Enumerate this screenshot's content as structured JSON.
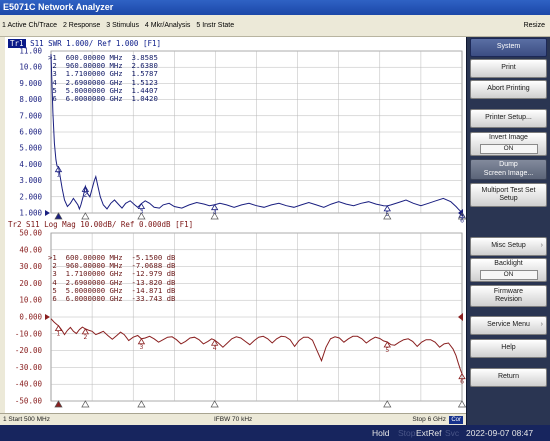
{
  "window": {
    "title": "E5071C Network Analyzer"
  },
  "menu": {
    "items": [
      "1 Active Ch/Trace",
      "2 Response",
      "3 Stimulus",
      "4 Mkr/Analysis",
      "5 Instr State"
    ],
    "resize_label": "Resize"
  },
  "chart_data": [
    {
      "type": "line",
      "trace_tag": "Tr1",
      "header": "S11  SWR 1.000/ Ref 1.000 [F1]",
      "y_tick_labels": [
        "11.00",
        "10.00",
        "9.000",
        "8.000",
        "7.000",
        "6.000",
        "5.000",
        "4.000",
        "3.000",
        "2.000",
        "1.000"
      ],
      "ylim": [
        1,
        11
      ],
      "xlim_mhz": [
        500,
        6000
      ],
      "reference_marker_label": "1.000",
      "markers": [
        {
          "id": "1",
          "freq": "600.00000 MHz",
          "x_mhz": 600,
          "value": "3.8585",
          "y": 3.8585
        },
        {
          "id": "2",
          "freq": "960.00000 MHz",
          "x_mhz": 960,
          "value": "2.6380",
          "y": 2.638
        },
        {
          "id": "3",
          "freq": "1.7100000 GHz",
          "x_mhz": 1710,
          "value": "1.5787",
          "y": 1.5787
        },
        {
          "id": "4",
          "freq": "2.6900000 GHz",
          "x_mhz": 2690,
          "value": "1.5123",
          "y": 1.5123
        },
        {
          "id": "5",
          "freq": "5.0000000 GHz",
          "x_mhz": 5000,
          "value": "1.4407",
          "y": 1.4407
        },
        {
          "id": "6",
          "freq": "6.0000000 GHz",
          "x_mhz": 6000,
          "value": "1.0420",
          "y": 1.042
        }
      ],
      "series": [
        {
          "x": [
            500,
            510,
            525,
            545,
            565,
            580,
            600,
            620,
            650,
            680,
            720,
            760,
            800,
            830,
            860,
            880,
            900,
            930,
            960,
            990,
            1020,
            1050,
            1080,
            1100,
            1130,
            1160,
            1200,
            1250,
            1300,
            1350,
            1400,
            1450,
            1500,
            1560,
            1620,
            1660,
            1710,
            1760,
            1820,
            1880,
            1950,
            2000,
            2080,
            2150,
            2250,
            2350,
            2450,
            2550,
            2620,
            2690,
            2760,
            2850,
            2950,
            3050,
            3150,
            3250,
            3350,
            3450,
            3550,
            3650,
            3750,
            3850,
            3950,
            4050,
            4150,
            4250,
            4350,
            4450,
            4550,
            4650,
            4750,
            4850,
            4950,
            5000,
            5050,
            5150,
            5250,
            5350,
            5450,
            5550,
            5650,
            5750,
            5850,
            5920,
            5960,
            6000
          ],
          "y": [
            10.8,
            9.5,
            7.2,
            5.3,
            4.3,
            3.9,
            3.86,
            3.3,
            2.5,
            1.8,
            1.4,
            1.6,
            1.9,
            1.7,
            1.5,
            1.25,
            1.5,
            2.0,
            2.64,
            2.2,
            2.0,
            2.5,
            3.0,
            3.25,
            2.6,
            2.0,
            1.5,
            1.25,
            1.6,
            1.8,
            1.55,
            1.3,
            1.6,
            1.75,
            1.5,
            1.35,
            1.58,
            1.75,
            1.6,
            1.35,
            1.3,
            1.5,
            1.6,
            1.4,
            1.3,
            1.5,
            1.65,
            1.55,
            1.45,
            1.51,
            1.6,
            1.5,
            1.35,
            1.5,
            1.6,
            1.45,
            1.35,
            1.5,
            1.6,
            1.45,
            1.35,
            1.5,
            1.65,
            1.5,
            1.35,
            1.55,
            1.7,
            1.55,
            1.45,
            1.6,
            1.7,
            1.55,
            1.45,
            1.44,
            1.5,
            1.65,
            1.8,
            1.6,
            1.45,
            1.6,
            1.75,
            1.9,
            1.7,
            1.4,
            1.2,
            1.04
          ]
        }
      ],
      "color": "#1a1f80"
    },
    {
      "type": "line",
      "trace_tag": "Tr2",
      "header": "Tr2 S11 Log Mag 10.00dB/ Ref 0.000dB [F1]",
      "y_tick_labels": [
        "50.00",
        "40.00",
        "30.00",
        "20.00",
        "10.00",
        "0.000",
        "-10.00",
        "-20.00",
        "-30.00",
        "-40.00",
        "-50.00"
      ],
      "ylim": [
        -50,
        50
      ],
      "xlim_mhz": [
        500,
        6000
      ],
      "reference_marker_label": "0.000",
      "markers": [
        {
          "id": "1",
          "freq": "600.00000 MHz",
          "x_mhz": 600,
          "value": "-5.1500 dB",
          "y": -5.15
        },
        {
          "id": "2",
          "freq": "960.00000 MHz",
          "x_mhz": 960,
          "value": "-7.0688 dB",
          "y": -7.0688
        },
        {
          "id": "3",
          "freq": "1.7100000 GHz",
          "x_mhz": 1710,
          "value": "-12.979 dB",
          "y": -12.979
        },
        {
          "id": "4",
          "freq": "2.6900000 GHz",
          "x_mhz": 2690,
          "value": "-13.820 dB",
          "y": -13.82
        },
        {
          "id": "5",
          "freq": "5.0000000 GHz",
          "x_mhz": 5000,
          "value": "-14.871 dB",
          "y": -14.871
        },
        {
          "id": "6",
          "freq": "6.0000000 GHz",
          "x_mhz": 6000,
          "value": "-33.743 dB",
          "y": -33.743
        }
      ],
      "series": [
        {
          "x": [
            500,
            540,
            580,
            600,
            640,
            680,
            720,
            760,
            800,
            840,
            880,
            920,
            960,
            1000,
            1050,
            1100,
            1150,
            1200,
            1260,
            1320,
            1380,
            1430,
            1480,
            1540,
            1600,
            1660,
            1710,
            1760,
            1820,
            1880,
            1940,
            2000,
            2060,
            2120,
            2180,
            2240,
            2300,
            2360,
            2420,
            2480,
            2540,
            2600,
            2650,
            2690,
            2740,
            2800,
            2860,
            2920,
            2980,
            3040,
            3100,
            3160,
            3220,
            3280,
            3340,
            3400,
            3460,
            3520,
            3580,
            3640,
            3700,
            3760,
            3820,
            3880,
            3940,
            4000,
            4060,
            4120,
            4180,
            4240,
            4300,
            4360,
            4420,
            4480,
            4540,
            4600,
            4660,
            4720,
            4780,
            4840,
            4900,
            4950,
            5000,
            5050,
            5100,
            5160,
            5220,
            5280,
            5340,
            5400,
            5460,
            5520,
            5580,
            5640,
            5700,
            5760,
            5820,
            5880,
            5920,
            5950,
            5980,
            6000
          ],
          "y": [
            -1.0,
            -3.0,
            -4.5,
            -5.15,
            -7.5,
            -10.5,
            -8.0,
            -6.2,
            -8.5,
            -9.8,
            -7.5,
            -6.0,
            -7.07,
            -7.8,
            -8.5,
            -10.5,
            -9.5,
            -8.5,
            -11.0,
            -13.2,
            -11.0,
            -9.0,
            -10.5,
            -14.0,
            -12.0,
            -11.0,
            -12.98,
            -12.5,
            -11.5,
            -13.0,
            -15.0,
            -13.5,
            -12.0,
            -11.8,
            -13.5,
            -16.0,
            -14.5,
            -12.5,
            -12.0,
            -13.5,
            -16.0,
            -14.5,
            -13.0,
            -13.82,
            -15.5,
            -18.0,
            -15.5,
            -13.0,
            -11.8,
            -12.5,
            -14.5,
            -16.5,
            -14.0,
            -12.0,
            -11.5,
            -13.0,
            -15.5,
            -13.0,
            -11.5,
            -11.8,
            -13.5,
            -17.5,
            -14.0,
            -12.0,
            -12.0,
            -13.8,
            -20.0,
            -26.0,
            -18.0,
            -13.0,
            -11.8,
            -12.5,
            -15.0,
            -13.0,
            -11.5,
            -11.5,
            -13.0,
            -15.5,
            -13.5,
            -12.0,
            -12.8,
            -14.2,
            -14.87,
            -16.5,
            -16.8,
            -15.0,
            -13.5,
            -13.0,
            -14.5,
            -17.5,
            -15.0,
            -13.5,
            -13.5,
            -15.0,
            -18.0,
            -16.0,
            -15.5,
            -19.0,
            -23.0,
            -27.5,
            -31.5,
            -33.74
          ]
        }
      ],
      "color": "#8a2020"
    }
  ],
  "status_bar": {
    "start": "1  Start 500 MHz",
    "ifbw": "IFBW 70 kHz",
    "stop": "Stop 6 GHz",
    "cor": "Cor"
  },
  "instrument_status": {
    "hold": "Hold",
    "stop": "Stop",
    "extref": "ExtRef",
    "svc": "Svc",
    "datetime": "2022-09-07 08:47"
  },
  "softkeys": {
    "system": "System",
    "print": "Print",
    "abort_printing": "Abort Printing",
    "printer_setup": "Printer Setup...",
    "invert_image": "Invert Image",
    "invert_image_value": "ON",
    "dump_line1": "Dump",
    "dump_line2": "Screen Image...",
    "multiport_line1": "Multiport Test Set",
    "multiport_line2": "Setup",
    "misc_setup": "Misc Setup",
    "backlight": "Backlight",
    "backlight_value": "ON",
    "firmware_line1": "Firmware",
    "firmware_line2": "Revision",
    "service_menu": "Service Menu",
    "help": "Help",
    "return": "Return"
  },
  "colors": {
    "trace1": "#1a1f80",
    "trace2": "#8a2020",
    "grid": "#b8b8b8",
    "softkey_panel": "#2a3552",
    "status_bar": "#17255e"
  }
}
